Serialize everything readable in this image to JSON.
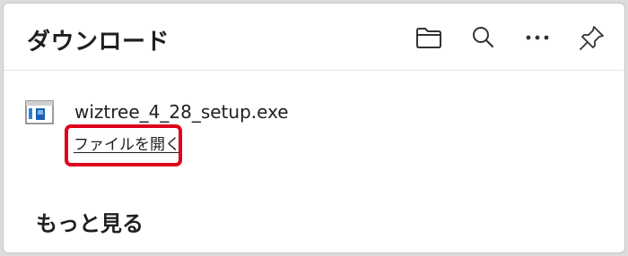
{
  "header": {
    "title": "ダウンロード",
    "actions": [
      {
        "name": "open-folder",
        "icon": "folder-icon"
      },
      {
        "name": "search",
        "icon": "search-icon"
      },
      {
        "name": "more-options",
        "icon": "more-icon"
      },
      {
        "name": "pin",
        "icon": "pin-icon"
      }
    ]
  },
  "downloads": [
    {
      "file_name": "wiztree_4_28_setup.exe",
      "icon": "exe-file-icon",
      "action_label": "ファイルを開く"
    }
  ],
  "footer": {
    "more_label": "もっと見る"
  },
  "colors": {
    "highlight": "#e0001b",
    "text": "#1f1f1f",
    "divider": "#e3e3e3"
  }
}
